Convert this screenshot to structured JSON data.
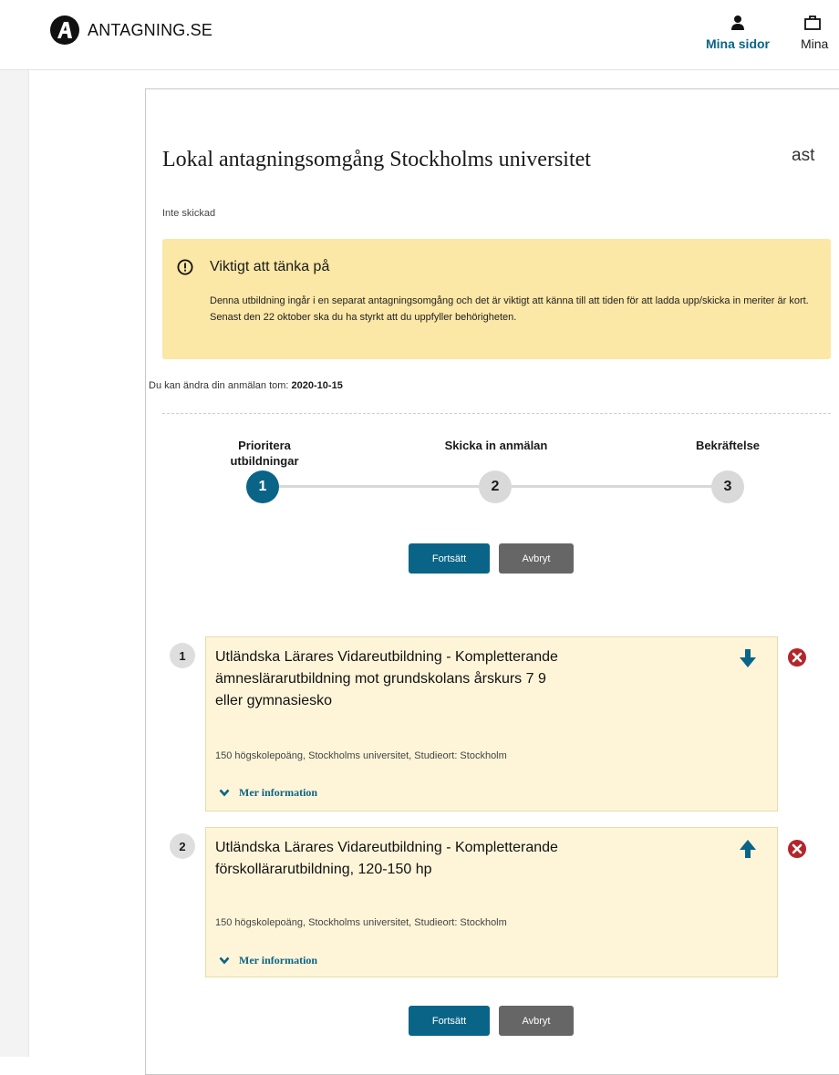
{
  "header": {
    "logo_text": "ANTAGNING.SE",
    "nav": [
      {
        "label": "Mina sidor",
        "icon": "user-icon"
      },
      {
        "label": "Mina",
        "icon": "briefcase-icon"
      }
    ]
  },
  "page": {
    "title": "Lokal antagningsomgång Stockholms universitet",
    "cut_text": "ast",
    "status": "Inte skickad"
  },
  "warning": {
    "icon": "exclamation-circle-icon",
    "title": "Viktigt att tänka på",
    "text": "Denna utbildning ingår i en separat antagningsomgång och det är viktigt att känna till att tiden för att ladda upp/skicka in meriter är kort. Senast den 22 oktober ska du ha styrkt att du uppfyller behörigheten."
  },
  "deadline": {
    "label": "Du kan ändra din anmälan tom:",
    "date": "2020-10-15"
  },
  "stepper": {
    "steps": [
      {
        "number": "1",
        "label": "Prioritera utbildningar",
        "active": true
      },
      {
        "number": "2",
        "label": "Skicka in anmälan",
        "active": false
      },
      {
        "number": "3",
        "label": "Bekräftelse",
        "active": false
      }
    ]
  },
  "buttons": {
    "continue": "Fortsätt",
    "cancel": "Avbryt"
  },
  "courses": [
    {
      "priority": "1",
      "title": "Utländska Lärares Vidareutbildning - Kompletterande ämneslärarutbildning mot grundskolans årskurs 7 9 eller gymnasiesko",
      "meta": "150 högskolepoäng, Stockholms universitet, Studieort: Stockholm",
      "more_info": "Mer information",
      "move_icon": "arrow-down-icon"
    },
    {
      "priority": "2",
      "title": "Utländska Lärares Vidareutbildning - Kompletterande förskollärarutbildning, 120-150 hp",
      "meta": "150 högskolepoäng, Stockholms universitet, Studieort: Stockholm",
      "more_info": "Mer information",
      "move_icon": "arrow-up-icon"
    }
  ],
  "colors": {
    "brand": "#0a6487",
    "warning_bg": "#fbe7a6",
    "course_bg": "#fef5d9",
    "remove_red": "#b3262b"
  }
}
